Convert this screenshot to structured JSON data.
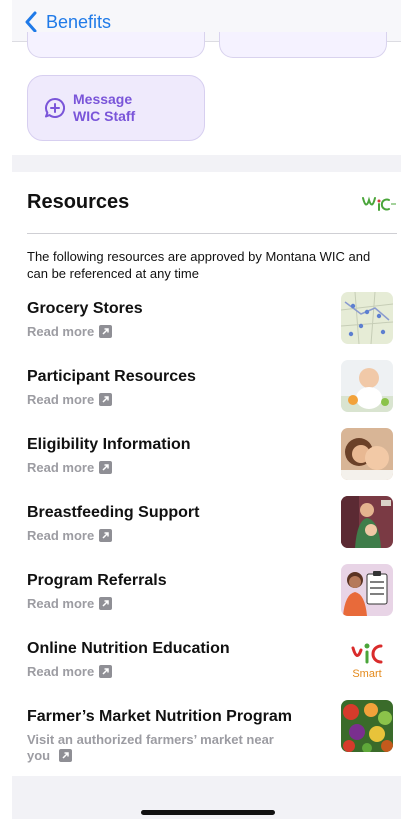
{
  "nav": {
    "back_label": "Benefits"
  },
  "message_card": {
    "label": "Message\nWIC Staff"
  },
  "resources": {
    "title": "Resources",
    "logo_text": "WIC",
    "intro": "The following resources are approved by Montana WIC and can be referenced at any time",
    "items": [
      {
        "title": "Grocery Stores",
        "link": "Read more",
        "thumb": "map-thumbnail"
      },
      {
        "title": "Participant Resources",
        "link": "Read more",
        "thumb": "baby-thumbnail"
      },
      {
        "title": "Eligibility Information",
        "link": "Read more",
        "thumb": "mother-child-thumbnail"
      },
      {
        "title": "Breastfeeding Support",
        "link": "Read more",
        "thumb": "breastfeeding-thumbnail"
      },
      {
        "title": "Program Referrals",
        "link": "Read more",
        "thumb": "clipboard-thumbnail"
      },
      {
        "title": "Online Nutrition Education",
        "link": "Read more",
        "thumb": "wic-smart-logo"
      },
      {
        "title": "Farmer’s Market Nutrition Program",
        "desc": "Visit an authorized farmers’ market near you",
        "thumb": "vegetables-thumbnail"
      }
    ],
    "smart_logo_text": "Smart"
  },
  "colors": {
    "accent": "#1f7ae8",
    "message_purple": "#7a55d9",
    "muted": "#9c9ca2"
  }
}
